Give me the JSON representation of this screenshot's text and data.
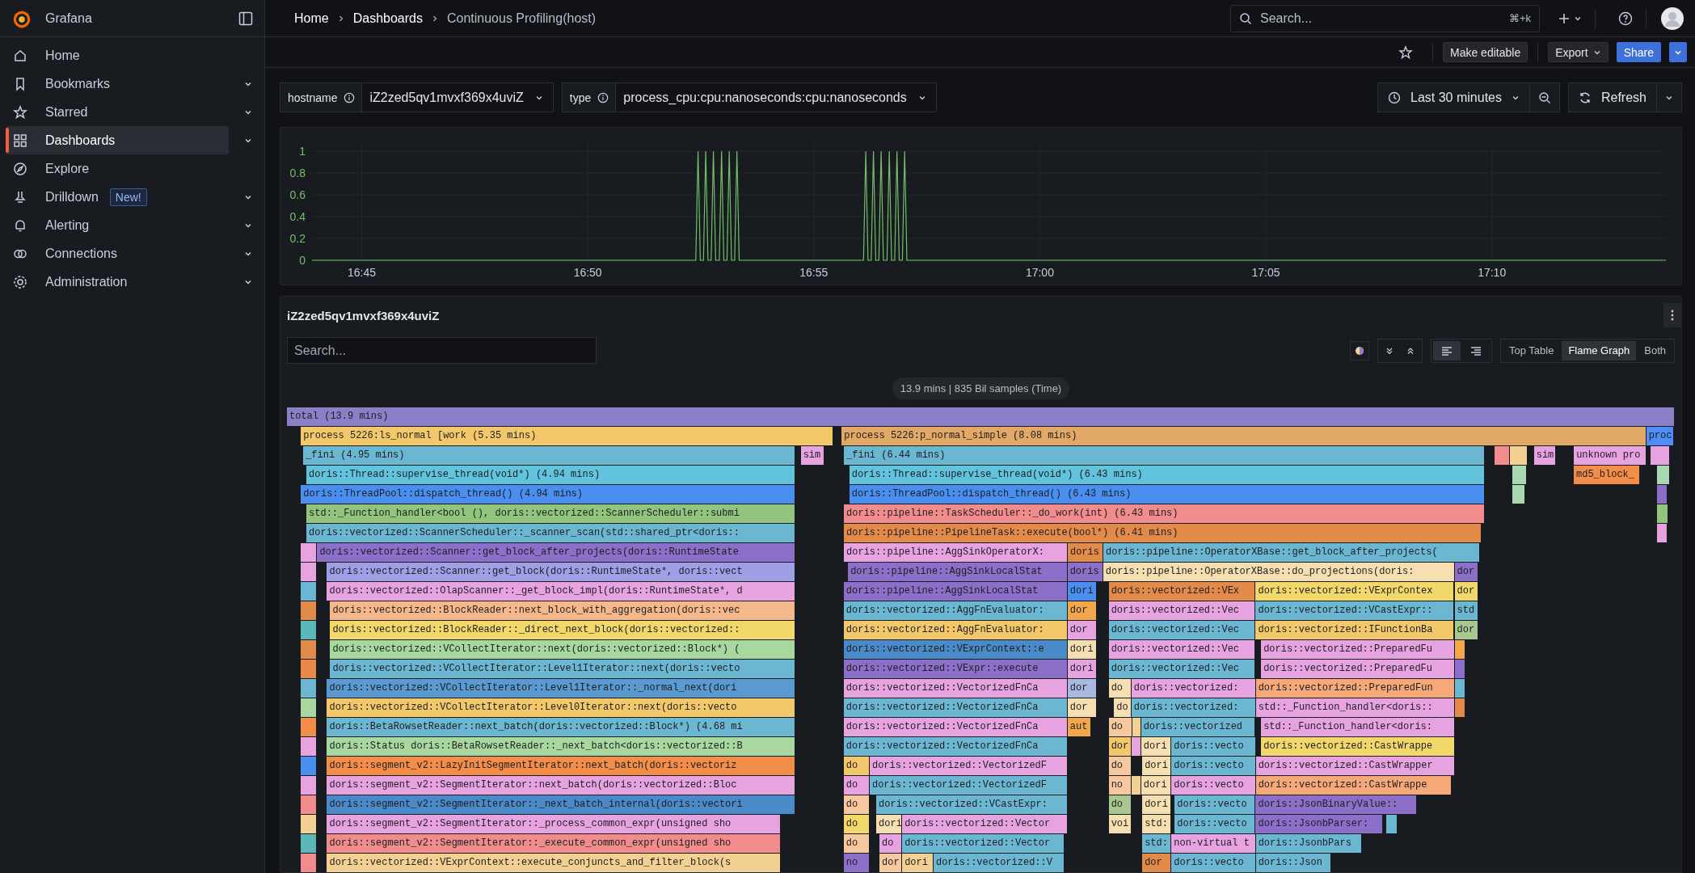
{
  "topbar": {
    "app_name": "Grafana",
    "breadcrumbs": [
      "Home",
      "Dashboards",
      "Continuous Profiling(host)"
    ],
    "search": {
      "placeholder": "Search...",
      "shortcut": "⌘+k"
    }
  },
  "sidebar": {
    "items": [
      {
        "label": "Home",
        "selected": false,
        "expandable": false
      },
      {
        "label": "Bookmarks",
        "selected": false,
        "expandable": true
      },
      {
        "label": "Starred",
        "selected": false,
        "expandable": true
      },
      {
        "label": "Dashboards",
        "selected": true,
        "expandable": true
      },
      {
        "label": "Explore",
        "selected": false,
        "expandable": false
      },
      {
        "label": "Drilldown",
        "selected": false,
        "expandable": true,
        "badge": "New!"
      },
      {
        "label": "Alerting",
        "selected": false,
        "expandable": true
      },
      {
        "label": "Connections",
        "selected": false,
        "expandable": true
      },
      {
        "label": "Administration",
        "selected": false,
        "expandable": true
      }
    ]
  },
  "toolbar": {
    "buttons": [
      {
        "label": "Make editable",
        "kind": "plain"
      },
      {
        "label": "Export",
        "kind": "dropdown"
      },
      {
        "label": "Share",
        "kind": "primary"
      }
    ]
  },
  "variables": [
    {
      "label": "hostname",
      "value": "iZ2zed5qv1mvxf369x4uviZ"
    },
    {
      "label": "type",
      "value": "process_cpu:cpu:nanoseconds:cpu:nanoseconds"
    }
  ],
  "time_picker": {
    "range": "Last 30 minutes",
    "refresh": "Refresh"
  },
  "chart_panel": {
    "chart_data": {
      "type": "line",
      "grid": true,
      "x": [
        1003.9,
        1012.39,
        1012.44,
        1012.49,
        1012.56,
        1012.61,
        1012.66,
        1012.73,
        1012.78,
        1012.83,
        1012.91,
        1012.96,
        1013.01,
        1013.08,
        1013.13,
        1013.18,
        1013.25,
        1013.3,
        1013.35,
        1016.1,
        1016.15,
        1016.2,
        1016.27,
        1016.32,
        1016.37,
        1016.44,
        1016.49,
        1016.54,
        1016.62,
        1016.67,
        1016.72,
        1016.79,
        1016.84,
        1016.89,
        1016.96,
        1017.01,
        1017.06,
        1033.85
      ],
      "series": [
        {
          "color": "#73bf69",
          "values": [
            0,
            0,
            1,
            0,
            0,
            1,
            0,
            0,
            1,
            0,
            0,
            1,
            0,
            0,
            1,
            0,
            0,
            1,
            0,
            0,
            1,
            0,
            0,
            1,
            0,
            0,
            1,
            0,
            0,
            1,
            0,
            0,
            1,
            0,
            0,
            1,
            0,
            0
          ]
        }
      ],
      "xlim": [
        1003.9,
        1033.85
      ],
      "ylim": [
        0,
        1
      ],
      "xticks": [
        {
          "value": 1005,
          "label": "16:45"
        },
        {
          "value": 1010,
          "label": "16:50"
        },
        {
          "value": 1015,
          "label": "16:55"
        },
        {
          "value": 1020,
          "label": "17:00"
        },
        {
          "value": 1025,
          "label": "17:05"
        },
        {
          "value": 1030,
          "label": "17:10"
        }
      ],
      "yticks": [
        0,
        {
          "value": 0.2,
          "label": "0.2"
        },
        {
          "value": 0.4,
          "label": "0.4"
        },
        {
          "value": 0.6,
          "label": "0.6"
        },
        {
          "value": 0.8,
          "label": "0.8"
        },
        1
      ]
    }
  },
  "flame_panel": {
    "title": "iZ2zed5qv1mvxf369x4uviZ",
    "search": {
      "placeholder": "Search..."
    },
    "align": [
      {
        "kind": "left",
        "selected": true
      },
      {
        "kind": "right",
        "selected": false
      }
    ],
    "views": [
      {
        "label": "Top Table",
        "selected": false
      },
      {
        "label": "Flame Graph",
        "selected": true
      },
      {
        "label": "Both",
        "selected": false
      }
    ],
    "summary": "13.9 mins | 835 Bil samples (Time)",
    "rows": [
      {
        "frames": [
          {
            "color": "#8b80c8",
            "label": "total (13.9 mins)"
          }
        ]
      },
      {
        "frames": [
          {
            "color": "#f2c86b",
            "label": "process 5226:ls_normal [work (5.35 mins)"
          },
          {
            "color": "#e2a866",
            "label": "process 5226:p_normal_simple (8.08 mins)"
          },
          {
            "color": "#4f8ef7",
            "label": "proc"
          }
        ]
      },
      {
        "frames": [
          {
            "color": "#6bb6d1",
            "label": "_fini (4.95 mins)"
          },
          {
            "color": "#e6a3e0",
            "label": "sim"
          },
          {
            "color": "#6bb6d1",
            "label": "_fini (6.44 mins)"
          },
          {
            "color": "#f08c8c"
          },
          {
            "color": "#f2d091"
          },
          {
            "color": "#e6a3e0",
            "label": "sim"
          },
          {
            "color": "#e6a3e0",
            "label": "unknown pro"
          },
          {
            "color": "#e6a3e0"
          }
        ]
      },
      {
        "frames": [
          {
            "color": "#62c3dc",
            "label": "doris::Thread::supervise_thread(void*) (4.94 mins)"
          },
          {
            "color": "#62c3dc",
            "label": "doris::Thread::supervise_thread(void*) (6.43 mins)"
          },
          {
            "color": "#a8d8b0"
          },
          {
            "color": "#f28d4a",
            "label": "md5_block_"
          },
          {
            "color": "#a8d8b0"
          }
        ]
      },
      {
        "frames": [
          {
            "color": "#4a8ef0",
            "label": "doris::ThreadPool::dispatch_thread() (4.94 mins)"
          },
          {
            "color": "#4a8ef0",
            "label": "doris::ThreadPool::dispatch_thread() (6.43 mins)"
          },
          {
            "color": "#a8d8b0"
          },
          {
            "color": "#8b6fc8"
          }
        ]
      },
      {
        "frames": [
          {
            "color": "#93c47d",
            "label": "std::_Function_handler<bool (), doris::vectorized::ScannerScheduler::submi"
          },
          {
            "color": "#f08c8c",
            "label": "doris::pipeline::TaskScheduler::_do_work(int) (6.43 mins)"
          },
          {
            "color": "#93c47d"
          }
        ]
      },
      {
        "frames": [
          {
            "color": "#6bb6d1",
            "label": "doris::vectorized::ScannerScheduler::_scanner_scan(std::shared_ptr<doris::"
          },
          {
            "color": "#e28a4a",
            "label": "doris::pipeline::PipelineTask::execute(bool*) (6.41 mins)"
          },
          {
            "color": "#e6a3e0"
          }
        ]
      },
      {
        "frames": [
          {
            "color": "#e6a3e0"
          },
          {
            "color": "#8b6fc8",
            "label": "doris::vectorized::Scanner::get_block_after_projects(doris::RuntimeState"
          },
          {
            "color": "#e6a3e0",
            "label": "doris::pipeline::AggSinkOperatorX:"
          },
          {
            "color": "#e28a4a",
            "label": "doris"
          },
          {
            "color": "#6bb6d1",
            "label": "doris::pipeline::OperatorXBase::get_block_after_projects("
          }
        ]
      },
      {
        "frames": [
          {
            "color": "#e6a3e0"
          },
          {
            "color": "#9f9fe6",
            "label": "doris::vectorized::Scanner::get_block(doris::RuntimeState*, doris::vect"
          },
          {
            "color": "#8b6fc8",
            "label": "doris::pipeline::AggSinkLocalStat"
          },
          {
            "color": "#8b6fc8",
            "label": "doris"
          },
          {
            "color": "#f5deb0",
            "label": "doris::pipeline::OperatorXBase::do_projections(doris:"
          },
          {
            "color": "#8b6fc8",
            "label": "dor"
          }
        ]
      },
      {
        "frames": [
          {
            "color": "#6bb6d1"
          },
          {
            "color": "#e6a3e0",
            "label": "doris::vectorized::OlapScanner::_get_block_impl(doris::RuntimeState*, d"
          },
          {
            "color": "#8b6fc8",
            "label": "doris::pipeline::AggSinkLocalStat"
          },
          {
            "color": "#4a8ef0",
            "label": "dori"
          },
          {
            "color": "#e28a4a",
            "label": "doris::vectorized::VEx"
          },
          {
            "color": "#f2d76b",
            "label": "doris::vectorized::VExprContex"
          },
          {
            "color": "#f2d76b",
            "label": "dor"
          }
        ]
      },
      {
        "frames": [
          {
            "color": "#e28a4a"
          },
          {
            "color": "#f5b88a",
            "label": "doris::vectorized::BlockReader::next_block_with_aggregation(doris::vec"
          },
          {
            "color": "#6bb6d1",
            "label": "doris::vectorized::AggFnEvaluator:"
          },
          {
            "color": "#f2a84a",
            "label": "dor"
          },
          {
            "color": "#e6a3e0",
            "label": "doris::vectorized::Vec"
          },
          {
            "color": "#6bb6d1",
            "label": "doris::vectorized::VCastExpr::"
          },
          {
            "color": "#6bb6d1",
            "label": "std"
          }
        ]
      },
      {
        "frames": [
          {
            "color": "#5ab8b8"
          },
          {
            "color": "#f2d76b",
            "label": "doris::vectorized::BlockReader::_direct_next_block(doris::vectorized::"
          },
          {
            "color": "#f2c86b",
            "label": "doris::vectorized::AggFnEvaluator:"
          },
          {
            "color": "#e6a3e0",
            "label": "dor"
          },
          {
            "color": "#6bb6d1",
            "label": "doris::vectorized::Vec"
          },
          {
            "color": "#f2c86b",
            "label": "doris::vectorized::IFunctionBa"
          },
          {
            "color": "#a8c890",
            "label": "dor"
          }
        ]
      },
      {
        "frames": [
          {
            "color": "#e28a4a"
          },
          {
            "color": "#a8d8a0",
            "label": "doris::vectorized::VCollectIterator::next(doris::vectorized::Block*) ("
          },
          {
            "color": "#4a8ac8",
            "label": "doris::vectorized::VExprContext::e"
          },
          {
            "color": "#f5deb0",
            "label": "dori"
          },
          {
            "color": "#e6a3e0",
            "label": "doris::vectorized::Vec"
          },
          {
            "color": "#e6a3e0",
            "label": "doris::vectorized::PreparedFu"
          },
          {
            "color": "#f2a84a"
          }
        ]
      },
      {
        "frames": [
          {
            "color": "#e8884a"
          },
          {
            "color": "#6bb6d1",
            "label": "doris::vectorized::VCollectIterator::Level1Iterator::next(doris::vecto"
          },
          {
            "color": "#8b6fc8",
            "label": "doris::vectorized::VExpr::execute"
          },
          {
            "color": "#e6a3e0",
            "label": "dori"
          },
          {
            "color": "#6bb6d1",
            "label": "doris::vectorized::Vec"
          },
          {
            "color": "#e6a3e0",
            "label": "doris::vectorized::PreparedFu"
          },
          {
            "color": "#8b6fc8"
          }
        ]
      },
      {
        "frames": [
          {
            "color": "#6bb6d1"
          },
          {
            "color": "#5a9ad0",
            "label": "doris::vectorized::VCollectIterator::Level1Iterator::_normal_next(dori"
          },
          {
            "color": "#e6a3e0",
            "label": "doris::vectorized::VectorizedFnCa"
          },
          {
            "color": "#a8b8e0",
            "label": "dor"
          },
          {
            "color": "#f5deb0",
            "label": "do"
          },
          {
            "color": "#e6a3e0",
            "label": "doris::vectorized:"
          },
          {
            "color": "#f5a878",
            "label": "doris::vectorized::PreparedFun"
          },
          {
            "color": "#6bb6d1"
          }
        ]
      },
      {
        "frames": [
          {
            "color": "#a8d8a0"
          },
          {
            "color": "#f2c86b",
            "label": "doris::vectorized::VCollectIterator::Level0Iterator::next(doris::vecto"
          },
          {
            "color": "#6bb6d1",
            "label": "doris::vectorized::VectorizedFnCa"
          },
          {
            "color": "#f5deb0",
            "label": "dor"
          },
          {
            "color": "#f5deb0",
            "label": "do"
          },
          {
            "color": "#6bb6d1",
            "label": "doris::vectorized:"
          },
          {
            "color": "#e6a3e0",
            "label": "std::_Function_handler<doris::"
          },
          {
            "color": "#e28a4a"
          }
        ]
      },
      {
        "frames": [
          {
            "color": "#f28d4a"
          },
          {
            "color": "#6bb6d1",
            "label": "doris::BetaRowsetReader::next_batch(doris::vectorized::Block*) (4.68 mi"
          },
          {
            "color": "#e6a3e0",
            "label": "doris::vectorized::VectorizedFnCa"
          },
          {
            "color": "#f2a84a",
            "label": "aut"
          },
          {
            "color": "#f5c8a0",
            "label": "do"
          },
          {
            "color": "#f2d091"
          },
          {
            "color": "#6bb6d1",
            "label": "doris::vectorized"
          },
          {
            "color": "#e6a3e0",
            "label": "std::_Function_handler<doris:"
          }
        ]
      },
      {
        "frames": [
          {
            "color": "#e6a3e0"
          },
          {
            "color": "#a8d8a0",
            "label": "doris::Status doris::BetaRowsetReader::_next_batch<doris::vectorized::B"
          },
          {
            "color": "#6bb6d1",
            "label": "doris::vectorized::VectorizedFnCa"
          },
          {
            "color": "#f2c86b",
            "label": "dor"
          },
          {
            "color": "#e6a3e0"
          },
          {
            "color": "#f5deb0",
            "label": "dori"
          },
          {
            "color": "#6bb6d1",
            "label": "doris::vecto"
          },
          {
            "color": "#f2d76b",
            "label": "doris::vectorized::CastWrappe"
          }
        ]
      },
      {
        "frames": [
          {
            "color": "#4a8ef0"
          },
          {
            "color": "#f28d4a",
            "label": "doris::segment_v2::LazyInitSegmentIterator::next_batch(doris::vectoriz"
          },
          {
            "color": "#f2c86b",
            "label": "do"
          },
          {
            "color": "#e6a3e0",
            "label": "doris::vectorized::VectorizedF"
          },
          {
            "color": "#f5c8a0",
            "label": "do"
          },
          {
            "color": "#f5deb0",
            "label": "dori"
          },
          {
            "color": "#6bb6d1",
            "label": "doris::vecto"
          },
          {
            "color": "#e6a3e0",
            "label": "doris::vectorized::CastWrapper"
          }
        ]
      },
      {
        "frames": [
          {
            "color": "#e6a3e0"
          },
          {
            "color": "#e6a3e0",
            "label": "doris::segment_v2::SegmentIterator::next_batch(doris::vectorized::Bloc"
          },
          {
            "color": "#e6a3e0",
            "label": "do"
          },
          {
            "color": "#6bb6d1",
            "label": "doris::vectorized::VectorizedF"
          },
          {
            "color": "#f5c8a0",
            "label": "no"
          },
          {
            "color": "#f2d091"
          },
          {
            "color": "#f5deb0",
            "label": "dori"
          },
          {
            "color": "#e6a3e0",
            "label": "doris::vecto"
          },
          {
            "color": "#f5a878",
            "label": "doris::vectorized::CastWrappe"
          }
        ]
      },
      {
        "frames": [
          {
            "color": "#f08c8c"
          },
          {
            "color": "#4a8ac8",
            "label": "doris::segment_v2::SegmentIterator::_next_batch_internal(doris::vectori"
          },
          {
            "color": "#f5c8a0",
            "label": "do"
          },
          {
            "color": "#6bb6d1",
            "label": "doris::vectorized::VCastExpr:"
          },
          {
            "color": "#a8c890",
            "label": "do"
          },
          {
            "color": "#f5deb0",
            "label": "dori"
          },
          {
            "color": "#6bb6d1",
            "label": "doris::vecto"
          },
          {
            "color": "#8b6fc8",
            "label": "doris::JsonBinaryValue::"
          }
        ]
      },
      {
        "frames": [
          {
            "color": "#f2d091"
          },
          {
            "color": "#e6a3e0",
            "label": "doris::segment_v2::SegmentIterator::_process_common_expr(unsigned sho"
          },
          {
            "color": "#f2d76b",
            "label": "do"
          },
          {
            "color": "#f5deb0",
            "label": "dori"
          },
          {
            "color": "#e6a3e0",
            "label": "doris::vectorized::Vector"
          },
          {
            "color": "#f5deb0",
            "label": "voi"
          },
          {
            "color": "#f5deb0",
            "label": "std:"
          },
          {
            "color": "#6bb6d1",
            "label": "doris::vecto"
          },
          {
            "color": "#8b6fc8",
            "label": "doris::JsonbParser:"
          },
          {
            "color": "#6bb6d1"
          }
        ]
      },
      {
        "frames": [
          {
            "color": "#5ab8b8"
          },
          {
            "color": "#f08c8c",
            "label": "doris::segment_v2::SegmentIterator::_execute_common_expr(unsigned sho"
          },
          {
            "color": "#f5c8a0",
            "label": "do"
          },
          {
            "color": "#e6a3e0",
            "label": "do"
          },
          {
            "color": "#6bb6d1",
            "label": "doris::vectorized::Vector"
          },
          {
            "color": "#6bb6d1",
            "label": "std:"
          },
          {
            "color": "#e6a3e0",
            "label": "non-virtual t"
          },
          {
            "color": "#6bb6d1",
            "label": "doris::JsonbPars"
          }
        ]
      },
      {
        "frames": [
          {
            "color": "#f08c8c"
          },
          {
            "color": "#f2d091",
            "label": "doris::vectorized::VExprContext::execute_conjuncts_and_filter_block(s"
          },
          {
            "color": "#8b6fc8",
            "label": "no"
          },
          {
            "color": "#f5c8a0",
            "label": "dor"
          },
          {
            "color": "#f2d091",
            "label": "dori"
          },
          {
            "color": "#6bb6d1",
            "label": "doris::vectorized::V"
          },
          {
            "color": "#e28a4a",
            "label": "dor"
          },
          {
            "color": "#6bb6d1",
            "label": "doris::vecto"
          },
          {
            "color": "#6bb6d1",
            "label": "doris::Json"
          }
        ]
      }
    ]
  }
}
